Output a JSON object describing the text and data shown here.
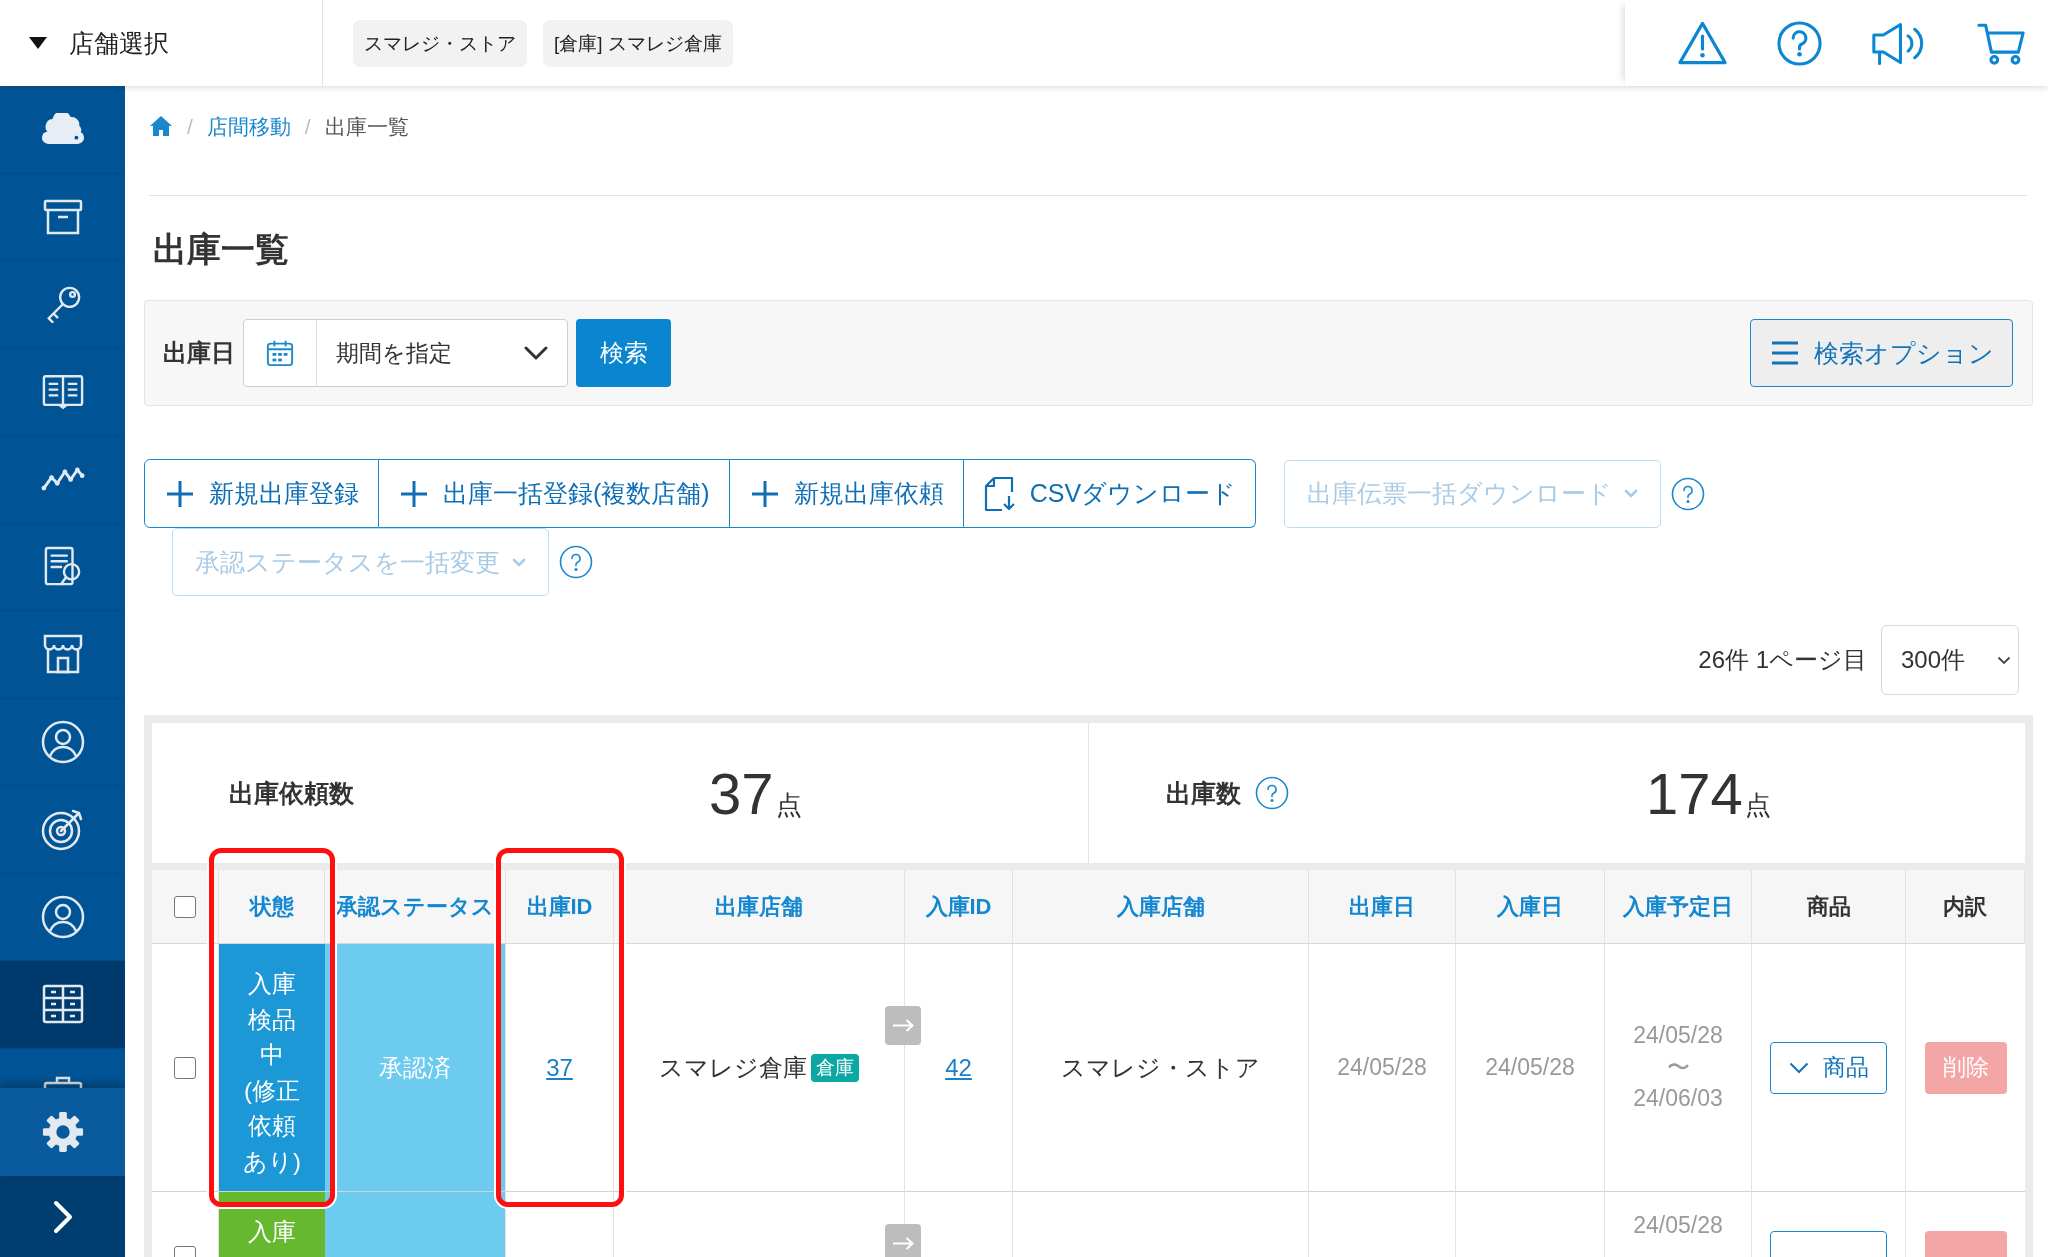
{
  "topbar": {
    "store_menu": "店舗選択",
    "store_chips": [
      "スマレジ・ストア",
      "[倉庫] スマレジ倉庫"
    ]
  },
  "sidebar": {
    "items": [
      {
        "selected": false
      },
      {
        "selected": false
      },
      {
        "selected": false
      },
      {
        "selected": false
      },
      {
        "selected": false
      },
      {
        "selected": false
      },
      {
        "selected": false
      },
      {
        "selected": false
      },
      {
        "selected": false
      },
      {
        "selected": false
      },
      {
        "selected": true
      },
      {
        "selected": false
      }
    ]
  },
  "breadcrumb": {
    "items": [
      {
        "separator": "/",
        "label": "店間移動",
        "current": false
      },
      {
        "separator": "/",
        "label": "出庫一覧",
        "current": true
      }
    ]
  },
  "page_title": "出庫一覧",
  "search": {
    "date_label": "出庫日",
    "period_select": "期間を指定",
    "search_button": "検索",
    "options_button": "検索オプション"
  },
  "actions": {
    "buttons": [
      {
        "kind": "add",
        "label": "新規出庫登録"
      },
      {
        "kind": "add",
        "label": "出庫一括登録(複数店舗)"
      },
      {
        "kind": "add",
        "label": "新規出庫依頼"
      },
      {
        "kind": "download",
        "label": "CSVダウンロード"
      }
    ],
    "dropdowns": [
      {
        "label": "出庫伝票一括ダウンロード",
        "disabled": true,
        "help": true
      },
      {
        "label": "承認ステータスを一括変更",
        "disabled": true,
        "help": true
      }
    ]
  },
  "pagination": {
    "summary": "26件 1ページ目",
    "page_size": "300件"
  },
  "summary": [
    {
      "label": "出庫依頼数",
      "help": false,
      "value": "37",
      "unit": "点"
    },
    {
      "label": "出庫数",
      "help": true,
      "value": "174",
      "unit": "点"
    }
  ],
  "table": {
    "select_all": {
      "checked": false
    },
    "columns": [
      {
        "label": "状態",
        "sortable": true,
        "highlighted": true
      },
      {
        "label": "承認ステータス",
        "sortable": true,
        "highlighted": false
      },
      {
        "label": "出庫ID",
        "sortable": true,
        "highlighted": true
      },
      {
        "label": "出庫店舗",
        "sortable": true,
        "highlighted": false
      },
      {
        "label": "入庫ID",
        "sortable": true,
        "highlighted": false
      },
      {
        "label": "入庫店舗",
        "sortable": true,
        "highlighted": false
      },
      {
        "label": "出庫日",
        "sortable": true,
        "highlighted": false
      },
      {
        "label": "入庫日",
        "sortable": true,
        "highlighted": false
      },
      {
        "label": "入庫予定日",
        "sortable": true,
        "highlighted": false
      },
      {
        "label": "商品",
        "sortable": false,
        "highlighted": false
      },
      {
        "label": "内訳",
        "sortable": false,
        "highlighted": false
      }
    ],
    "rows": [
      {
        "checked": false,
        "status": {
          "text": "入庫検品中",
          "note": "(修正依頼あり)",
          "color": "#1b98d5"
        },
        "approval": "承認済",
        "shipment_id": "37",
        "from_store": {
          "name": "スマレジ倉庫",
          "tag": "倉庫"
        },
        "receipt_id": "42",
        "to_store": "スマレジ・ストア",
        "ship_date": "24/05/28",
        "receive_date": "24/05/28",
        "scheduled": {
          "from": "24/05/28",
          "separator": "〜",
          "to": "24/06/03"
        },
        "products_button": "商品",
        "delete_button": {
          "label": "削除",
          "disabled": true
        }
      },
      {
        "checked": false,
        "status": {
          "text": "入庫",
          "color": "#66b82e"
        },
        "scheduled": {
          "from": "24/05/28"
        },
        "delete_button": {
          "disabled": true
        }
      }
    ]
  }
}
